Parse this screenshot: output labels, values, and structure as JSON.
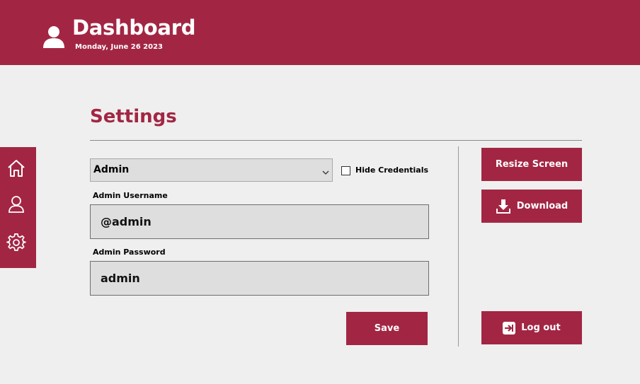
{
  "header": {
    "title": "Dashboard",
    "date": "Monday, June 26 2023",
    "icon": "user-icon"
  },
  "sidebar": {
    "items": [
      {
        "name": "home",
        "icon": "home-icon"
      },
      {
        "name": "profile",
        "icon": "user-outline-icon"
      },
      {
        "name": "settings",
        "icon": "gear-icon"
      }
    ]
  },
  "settings": {
    "title": "Settings",
    "account_select": {
      "value": "Admin"
    },
    "hide_credentials": {
      "label": "Hide Credentials",
      "checked": false
    },
    "username": {
      "label": "Admin Username",
      "value": "@admin"
    },
    "password": {
      "label": "Admin Password",
      "value": "admin"
    },
    "save_label": "Save"
  },
  "actions": {
    "resize_label": "Resize Screen",
    "download_label": "Download",
    "logout_label": "Log out"
  },
  "colors": {
    "accent": "#a22643",
    "background": "#efefef",
    "field_bg": "#dedede"
  }
}
